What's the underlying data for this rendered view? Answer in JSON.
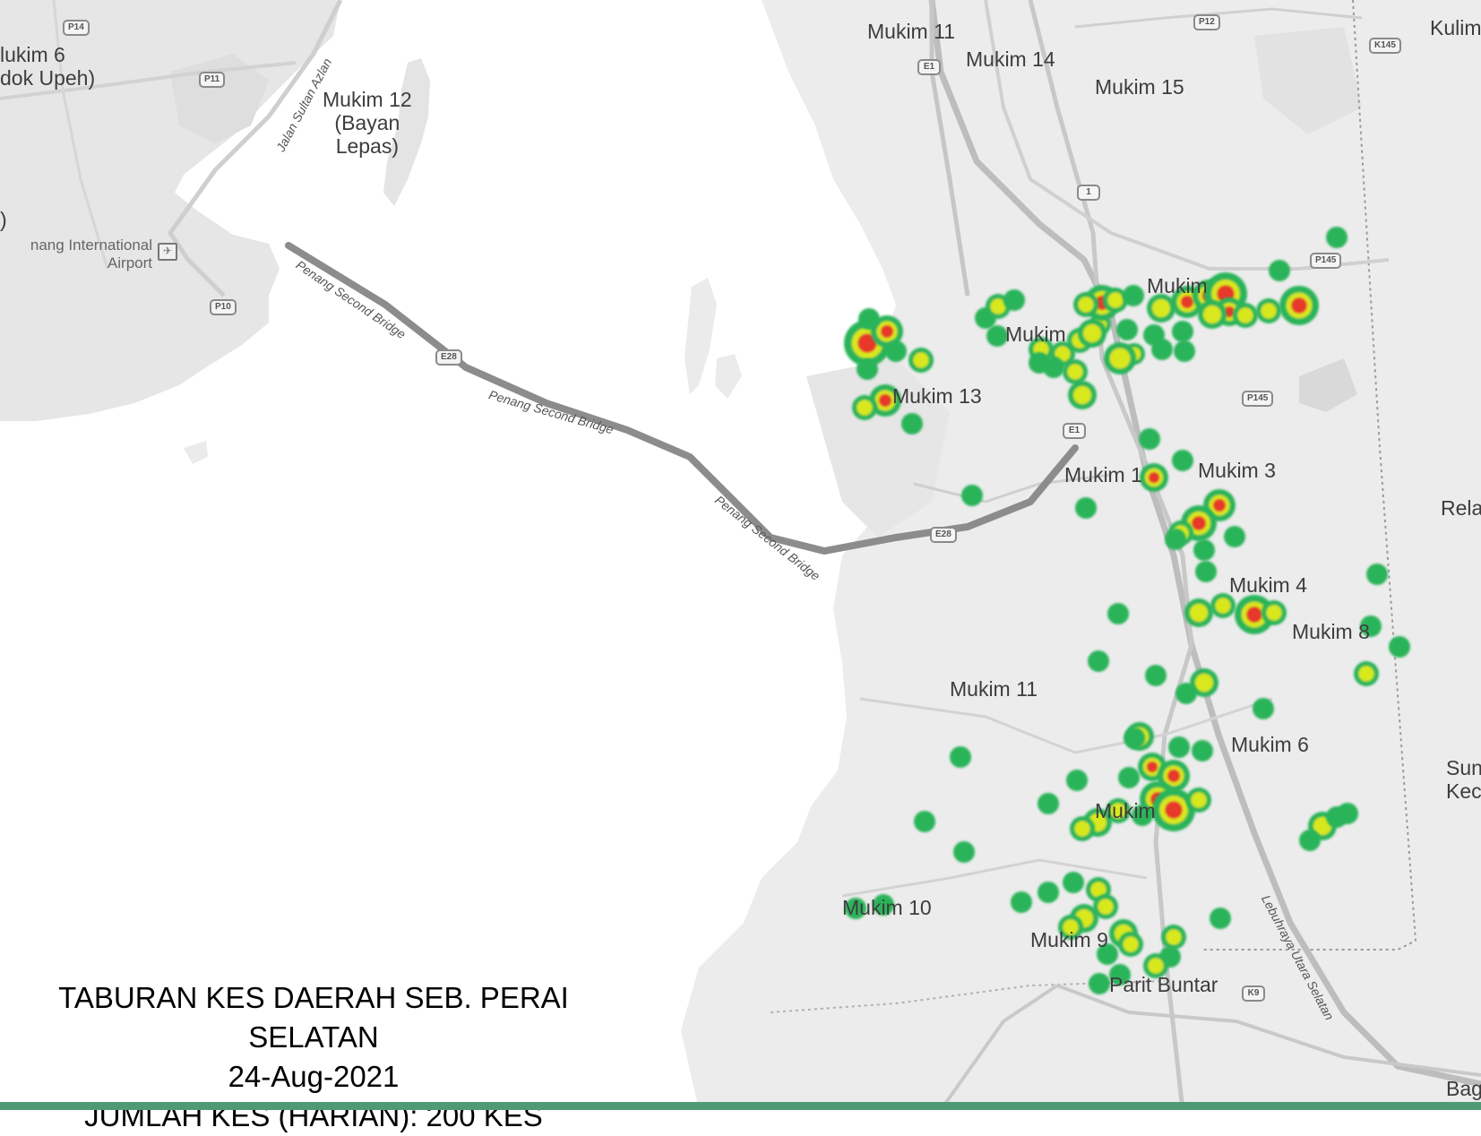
{
  "places": [
    {
      "id": "mukim-6-left",
      "text": "lukim 6\ndok Upeh)"
    },
    {
      "id": "mukim-12",
      "text": "Mukim 12\n(Bayan\nLepas)"
    },
    {
      "id": "airport",
      "text": "nang International\nAirport"
    },
    {
      "id": "left-edge",
      "text": ")"
    },
    {
      "id": "mukim-11-top",
      "text": "Mukim 11"
    },
    {
      "id": "mukim-14",
      "text": "Mukim 14"
    },
    {
      "id": "mukim-15",
      "text": "Mukim 15"
    },
    {
      "id": "kulim",
      "text": "Kulim"
    },
    {
      "id": "mukim-north",
      "text": "Mukim"
    },
    {
      "id": "mukim-mid",
      "text": "Mukim"
    },
    {
      "id": "mukim-13",
      "text": "Mukim 13"
    },
    {
      "id": "mukim-1",
      "text": "Mukim 1"
    },
    {
      "id": "mukim-3",
      "text": "Mukim 3"
    },
    {
      "id": "rela",
      "text": "Rela"
    },
    {
      "id": "mukim-4",
      "text": "Mukim 4"
    },
    {
      "id": "mukim-8",
      "text": "Mukim 8"
    },
    {
      "id": "mukim-11",
      "text": "Mukim 11"
    },
    {
      "id": "mukim-6",
      "text": "Mukim 6"
    },
    {
      "id": "sun-kec",
      "text": "Sun\nKec"
    },
    {
      "id": "mukim-south",
      "text": "Mukim"
    },
    {
      "id": "mukim-10",
      "text": "Mukim 10"
    },
    {
      "id": "mukim-9",
      "text": "Mukim 9"
    },
    {
      "id": "parit-buntar",
      "text": "Parit Buntar"
    },
    {
      "id": "bag",
      "text": "Bag"
    }
  ],
  "road_shields": [
    "P14",
    "P11",
    "P10",
    "E1",
    "P12",
    "K145",
    "P145",
    "1",
    "P145",
    "E28",
    "E1",
    "E28",
    "K9"
  ],
  "road_names": [
    "Jalan Sultan Azlan",
    "Penang Second Bridge",
    "Penang Second Bridge",
    "Penang Second Bridge",
    "Lebuhraya Utara Selatan"
  ],
  "caption": {
    "line1": "TABURAN KES DAERAH SEB. PERAI",
    "line2": "SELATAN",
    "line3": "24-Aug-2021",
    "line4": "JUMLAH KES (HARIAN): 200 KES"
  },
  "heatmap": {
    "colors": {
      "low": "#2bb45a",
      "mid": "#d8e81c",
      "high": "#e7382a"
    },
    "base_map_land": "#ececec",
    "sea": "#ffffff"
  }
}
